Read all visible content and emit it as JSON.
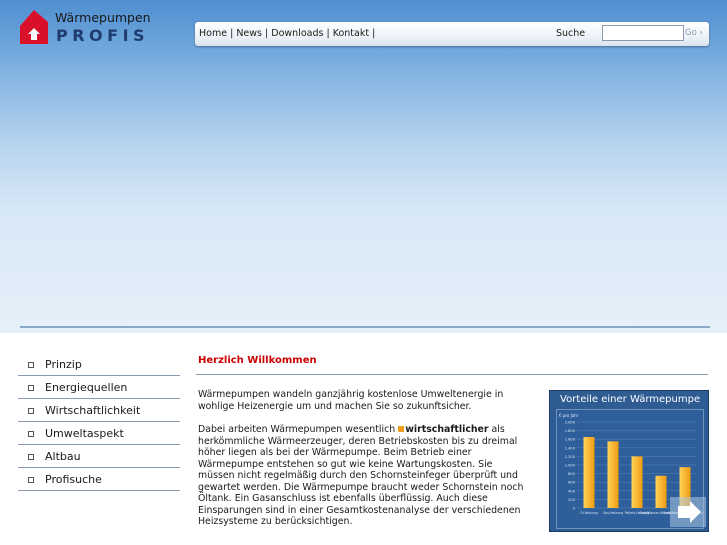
{
  "logo": {
    "line1": "Wärmepumpen",
    "line2": "PROFIS",
    "house_color": "#d8102a"
  },
  "nav": {
    "links": [
      "Home",
      "News",
      "Downloads",
      "Kontakt"
    ],
    "separator": "|",
    "search_label": "Suche",
    "search_value": "",
    "go_label": "Go ›"
  },
  "sidebar": {
    "items": [
      {
        "label": "Prinzip"
      },
      {
        "label": "Energiequellen"
      },
      {
        "label": "Wirtschaftlichkeit"
      },
      {
        "label": "Umweltaspekt"
      },
      {
        "label": "Altbau"
      },
      {
        "label": "Profisuche"
      }
    ]
  },
  "main": {
    "heading": "Herzlich Willkommen",
    "para1": "Wärmepumpen wandeln ganzjährig kostenlose Umweltenergie in wohlige Heizenergie um und machen Sie so zukunftsicher.",
    "para2_before": "Dabei arbeiten Wärmepumpen wesentlich ",
    "para2_link": "wirtschaftlicher",
    "para2_after": " als herkömmliche Wärmeerzeuger, deren Betriebskosten bis zu dreimal höher liegen als bei der Wärmepumpe. Beim Betrieb einer Wärmepumpe entstehen so gut wie keine Wartungskosten. Sie müssen nicht regelmäßig durch den Schornsteinfeger überprüft und gewartet werden. Die Wärmepumpe braucht weder Schornstein noch Öltank. Ein Gasanschluss ist ebenfalls überflüssig. Auch diese Einsparungen sind in einer Gesamtkostenanalyse der verschiedenen Heizsysteme zu berücksichtigen."
  },
  "widget": {
    "title": "Vorteile einer Wärmepumpe",
    "colors": {
      "bar_light": "#ffd35a",
      "bar_dark": "#f29a10",
      "panel": "#2d5b92",
      "arrow": "#aac4e0"
    },
    "chart_data": {
      "type": "bar",
      "categories": [
        "Öl-Heizung",
        "Gas-Heizung",
        "Pellets-Heizung",
        "Sole/Wasser-Wärmepumpe",
        "Luft/Wasser-Wärmepumpe"
      ],
      "values": [
        1650,
        1550,
        1200,
        750,
        950
      ],
      "ylabel": "€ pro Jahr",
      "ylim": [
        0,
        2000
      ],
      "yticks": [
        "2.000",
        "1.800",
        "1.600",
        "1.400",
        "1.200",
        "1.000",
        "800",
        "600",
        "400",
        "200",
        "0"
      ]
    }
  }
}
